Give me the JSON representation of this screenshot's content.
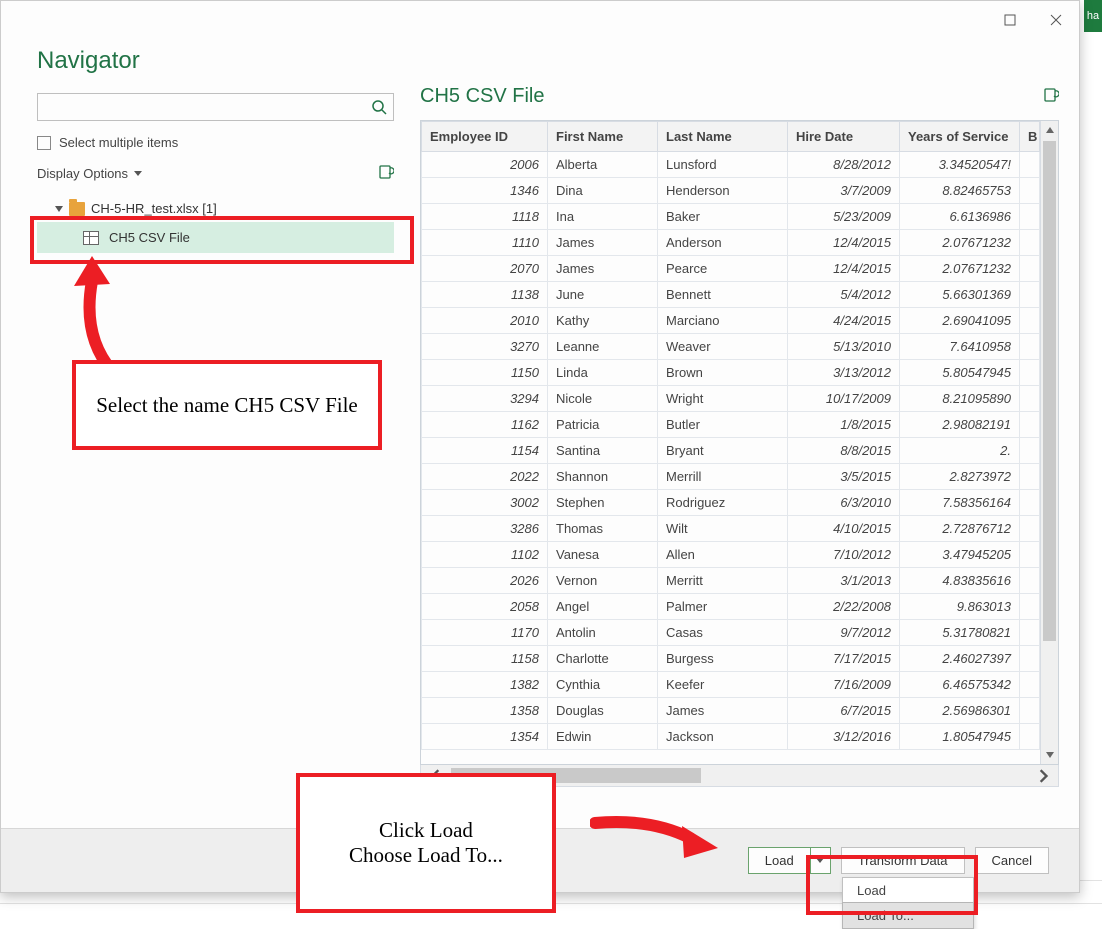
{
  "window": {
    "title": "Navigator",
    "right_title": "CH5 CSV File"
  },
  "left": {
    "search_placeholder": "",
    "multi_label": "Select multiple items",
    "display_options_label": "Display Options",
    "file_label": "CH-5-HR_test.xlsx [1]",
    "item_label": "CH5 CSV File"
  },
  "callouts": {
    "select_text": "Select the name CH5 CSV File",
    "load_text_line1": "Click Load",
    "load_text_line2": "Choose Load To..."
  },
  "table": {
    "headers": [
      "Employee ID",
      "First Name",
      "Last Name",
      "Hire Date",
      "Years of Service",
      "B"
    ],
    "rows": [
      {
        "id": "2006",
        "fn": "Alberta",
        "ln": "Lunsford",
        "hd": "8/28/2012",
        "ys": "3.34520547!"
      },
      {
        "id": "1346",
        "fn": "Dina",
        "ln": "Henderson",
        "hd": "3/7/2009",
        "ys": "8.82465753"
      },
      {
        "id": "1118",
        "fn": "Ina",
        "ln": "Baker",
        "hd": "5/23/2009",
        "ys": "6.6136986"
      },
      {
        "id": "1110",
        "fn": "James",
        "ln": "Anderson",
        "hd": "12/4/2015",
        "ys": "2.07671232"
      },
      {
        "id": "2070",
        "fn": "James",
        "ln": "Pearce",
        "hd": "12/4/2015",
        "ys": "2.07671232"
      },
      {
        "id": "1138",
        "fn": "June",
        "ln": "Bennett",
        "hd": "5/4/2012",
        "ys": "5.66301369"
      },
      {
        "id": "2010",
        "fn": "Kathy",
        "ln": "Marciano",
        "hd": "4/24/2015",
        "ys": "2.69041095"
      },
      {
        "id": "3270",
        "fn": "Leanne",
        "ln": "Weaver",
        "hd": "5/13/2010",
        "ys": "7.6410958"
      },
      {
        "id": "1150",
        "fn": "Linda",
        "ln": "Brown",
        "hd": "3/13/2012",
        "ys": "5.80547945"
      },
      {
        "id": "3294",
        "fn": "Nicole",
        "ln": "Wright",
        "hd": "10/17/2009",
        "ys": "8.21095890"
      },
      {
        "id": "1162",
        "fn": "Patricia",
        "ln": "Butler",
        "hd": "1/8/2015",
        "ys": "2.98082191"
      },
      {
        "id": "1154",
        "fn": "Santina",
        "ln": "Bryant",
        "hd": "8/8/2015",
        "ys": "2."
      },
      {
        "id": "2022",
        "fn": "Shannon",
        "ln": "Merrill",
        "hd": "3/5/2015",
        "ys": "2.8273972"
      },
      {
        "id": "3002",
        "fn": "Stephen",
        "ln": "Rodriguez",
        "hd": "6/3/2010",
        "ys": "7.58356164"
      },
      {
        "id": "3286",
        "fn": "Thomas",
        "ln": "Wilt",
        "hd": "4/10/2015",
        "ys": "2.72876712"
      },
      {
        "id": "1102",
        "fn": "Vanesa",
        "ln": "Allen",
        "hd": "7/10/2012",
        "ys": "3.47945205"
      },
      {
        "id": "2026",
        "fn": "Vernon",
        "ln": "Merritt",
        "hd": "3/1/2013",
        "ys": "4.83835616"
      },
      {
        "id": "2058",
        "fn": "Angel",
        "ln": "Palmer",
        "hd": "2/22/2008",
        "ys": "9.863013"
      },
      {
        "id": "1170",
        "fn": "Antolin",
        "ln": "Casas",
        "hd": "9/7/2012",
        "ys": "5.31780821"
      },
      {
        "id": "1158",
        "fn": "Charlotte",
        "ln": "Burgess",
        "hd": "7/17/2015",
        "ys": "2.46027397"
      },
      {
        "id": "1382",
        "fn": "Cynthia",
        "ln": "Keefer",
        "hd": "7/16/2009",
        "ys": "6.46575342"
      },
      {
        "id": "1358",
        "fn": "Douglas",
        "ln": "James",
        "hd": "6/7/2015",
        "ys": "2.56986301"
      },
      {
        "id": "1354",
        "fn": "Edwin",
        "ln": "Jackson",
        "hd": "3/12/2016",
        "ys": "1.80547945"
      }
    ]
  },
  "buttons": {
    "load": "Load",
    "transform": "Transform Data",
    "cancel": "Cancel",
    "menu_load": "Load",
    "menu_load_to": "Load To..."
  },
  "strip": "ha"
}
